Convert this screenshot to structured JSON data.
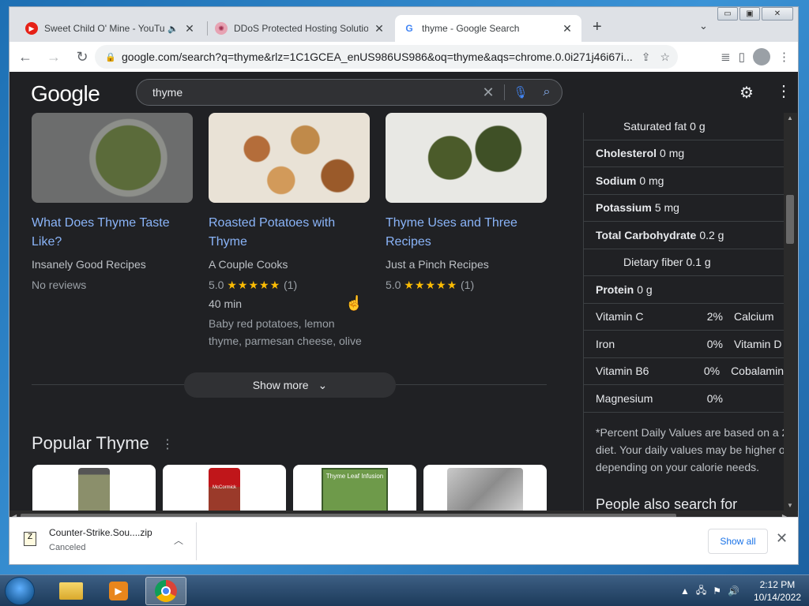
{
  "browser": {
    "tabs": [
      {
        "title": "Sweet Child O' Mine - YouTube",
        "audio_icon": "speaker-icon",
        "favicon": "youtube-icon",
        "active": false
      },
      {
        "title": "DDoS Protected Hosting Solutions",
        "favicon": "ddos-icon",
        "active": false
      },
      {
        "title": "thyme - Google Search",
        "favicon": "google-icon",
        "active": true
      }
    ],
    "new_tab_symbol": "+",
    "url": "google.com/search?q=thyme&rlz=1C1GCEA_enUS986US986&oq=thyme&aqs=chrome.0.0i271j46i67i..."
  },
  "google": {
    "logo": "Google",
    "query": "thyme"
  },
  "recipes": [
    {
      "title": "What Does Thyme Taste Like?",
      "source": "Insanely Good Recipes",
      "rating_text": "No reviews",
      "rating": null,
      "time": "",
      "desc": ""
    },
    {
      "title": "Roasted Potatoes with Thyme",
      "source": "A Couple Cooks",
      "rating": "5.0",
      "stars": "★★★★★",
      "count": "(1)",
      "time": "40 min",
      "desc": "Baby red potatoes, lemon thyme, parmesan cheese, olive"
    },
    {
      "title": "Thyme Uses and Three Recipes",
      "source": "Just a Pinch Recipes",
      "rating": "5.0",
      "stars": "★★★★★",
      "count": "(1)",
      "time": "",
      "desc": ""
    }
  ],
  "show_more": "Show more",
  "popular": {
    "heading": "Popular Thyme",
    "products": [
      {
        "label": ""
      },
      {
        "label": "McCormick"
      },
      {
        "label": "Thyme Leaf Infusion"
      },
      {
        "label": ""
      }
    ]
  },
  "nutrition": {
    "rows": [
      {
        "name": "Saturated fat",
        "value": "0 g",
        "bold": false,
        "indent": true
      },
      {
        "name": "Cholesterol",
        "value": "0 mg",
        "bold": true,
        "indent": false
      },
      {
        "name": "Sodium",
        "value": "0 mg",
        "bold": true,
        "indent": false
      },
      {
        "name": "Potassium",
        "value": "5 mg",
        "bold": true,
        "indent": false
      },
      {
        "name": "Total Carbohydrate",
        "value": "0.2 g",
        "bold": true,
        "indent": false
      },
      {
        "name": "Dietary fiber",
        "value": "0.1 g",
        "bold": false,
        "indent": true
      },
      {
        "name": "Protein",
        "value": "0 g",
        "bold": true,
        "indent": false
      }
    ],
    "vitamins": [
      {
        "left": "Vitamin C",
        "left_pct": "2%",
        "right": "Calcium"
      },
      {
        "left": "Iron",
        "left_pct": "0%",
        "right": "Vitamin D"
      },
      {
        "left": "Vitamin B6",
        "left_pct": "0%",
        "right": "Cobalamin"
      },
      {
        "left": "Magnesium",
        "left_pct": "0%",
        "right": ""
      }
    ],
    "footnote": [
      "*Percent Daily Values are based on a 2",
      "diet. Your daily values may be higher o",
      "depending on your calorie needs."
    ],
    "people_also": "People also search for"
  },
  "download": {
    "filename": "Counter-Strike.Sou....zip",
    "status": "Canceled",
    "show_all": "Show all"
  },
  "taskbar": {
    "time": "2:12 PM",
    "date": "10/14/2022"
  }
}
